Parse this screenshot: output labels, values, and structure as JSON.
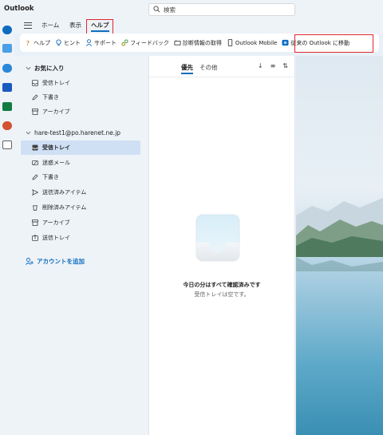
{
  "app": {
    "title": "Outlook"
  },
  "search": {
    "placeholder": "検索"
  },
  "ribbon": {
    "tabs": [
      {
        "label": "ホーム"
      },
      {
        "label": "表示"
      },
      {
        "label": "ヘルプ",
        "active": true
      }
    ],
    "commands": [
      {
        "label": "ヘルプ",
        "icon": "question-icon"
      },
      {
        "label": "ヒント",
        "icon": "lightbulb-icon"
      },
      {
        "label": "サポート",
        "icon": "person-support-icon"
      },
      {
        "label": "フィードバック",
        "icon": "feedback-icon"
      },
      {
        "label": "診断情報の取得",
        "icon": "diagnostics-icon"
      },
      {
        "label": "Outlook Mobile",
        "icon": "phone-icon"
      },
      {
        "label": "従来の Outlook に移動",
        "icon": "outlook-classic-icon"
      }
    ]
  },
  "folders": {
    "favorites": {
      "heading": "お気に入り",
      "items": [
        {
          "label": "受信トレイ",
          "icon": "inbox-icon"
        },
        {
          "label": "下書き",
          "icon": "draft-icon"
        },
        {
          "label": "アーカイブ",
          "icon": "archive-icon"
        }
      ]
    },
    "account": {
      "heading": "hare-test1@po.harenet.ne.jp",
      "items": [
        {
          "label": "受信トレイ",
          "icon": "inbox-icon",
          "selected": true
        },
        {
          "label": "迷惑メール",
          "icon": "junk-icon"
        },
        {
          "label": "下書き",
          "icon": "draft-icon"
        },
        {
          "label": "送信済みアイテム",
          "icon": "sent-icon"
        },
        {
          "label": "削除済みアイテム",
          "icon": "trash-icon"
        },
        {
          "label": "アーカイブ",
          "icon": "archive-icon"
        },
        {
          "label": "送信トレイ",
          "icon": "outbox-icon"
        }
      ]
    },
    "add_account": "アカウントを追加"
  },
  "message_list": {
    "tabs": [
      {
        "label": "優先",
        "active": true
      },
      {
        "label": "その他"
      }
    ],
    "empty_title": "今日の分はすべて確認済みです",
    "empty_subtitle": "受信トレイは空です。"
  },
  "colors": {
    "accent": "#0f6cbd",
    "highlight_box": "#e0262d"
  }
}
